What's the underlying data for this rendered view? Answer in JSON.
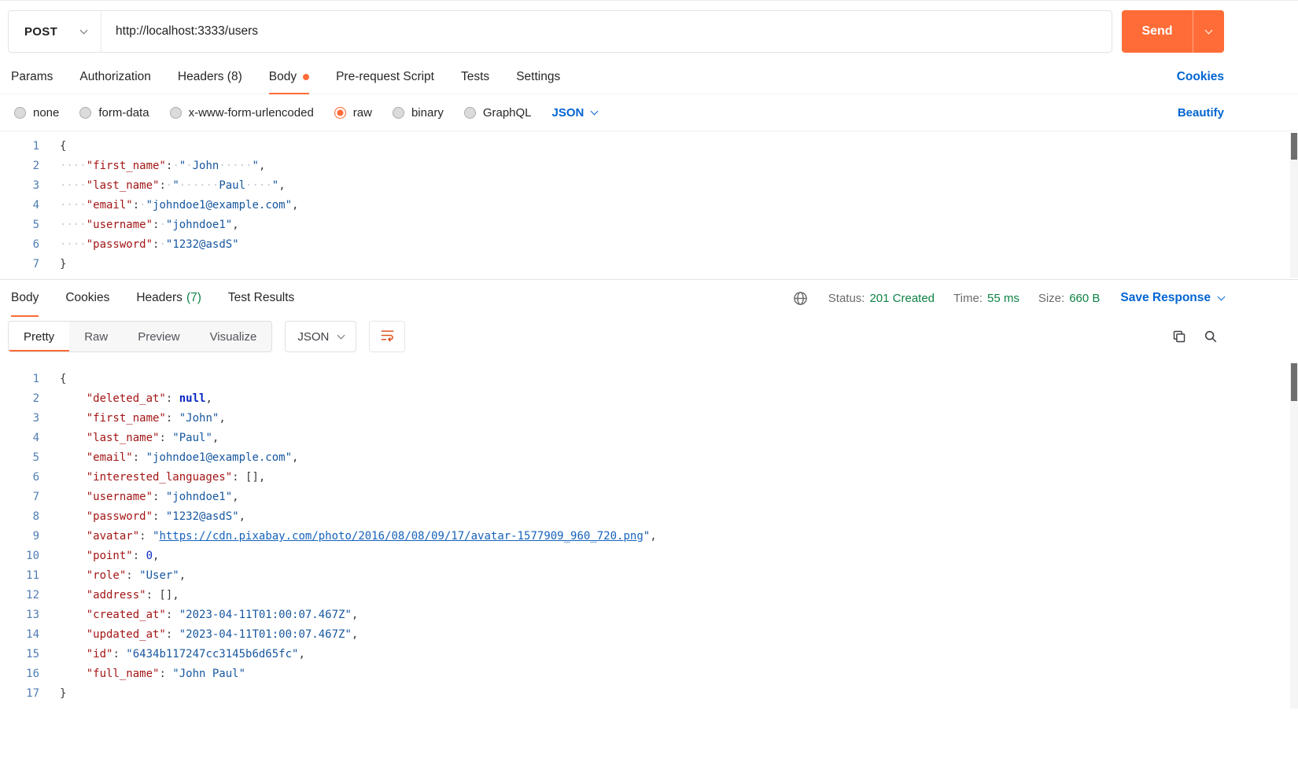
{
  "accent_color": "#FF6C37",
  "status_green": "#0E8345",
  "link_blue": "#0265D2",
  "request": {
    "method": "POST",
    "url": "http://localhost:3333/users",
    "send_label": "Send",
    "tabs": [
      "Params",
      "Authorization",
      "Headers (8)",
      "Body",
      "Pre-request Script",
      "Tests",
      "Settings"
    ],
    "active_tab": "Body",
    "cookies_link": "Cookies",
    "body_types": [
      "none",
      "form-data",
      "x-www-form-urlencoded",
      "raw",
      "binary",
      "GraphQL"
    ],
    "selected_body_type": "raw",
    "language": "JSON",
    "beautify_link": "Beautify",
    "editor_lines": [
      [
        {
          "c": "punc",
          "v": "{"
        }
      ],
      [
        {
          "c": "ws",
          "v": "····"
        },
        {
          "c": "key",
          "v": "\"first_name\""
        },
        {
          "c": "punc",
          "v": ":"
        },
        {
          "c": "ws",
          "v": "·"
        },
        {
          "c": "str",
          "v": "\""
        },
        {
          "c": "ws",
          "v": "·"
        },
        {
          "c": "str",
          "v": "John"
        },
        {
          "c": "ws",
          "v": "·····"
        },
        {
          "c": "str",
          "v": "\""
        },
        {
          "c": "punc",
          "v": ","
        }
      ],
      [
        {
          "c": "ws",
          "v": "····"
        },
        {
          "c": "key",
          "v": "\"last_name\""
        },
        {
          "c": "punc",
          "v": ":"
        },
        {
          "c": "ws",
          "v": "·"
        },
        {
          "c": "str",
          "v": "\""
        },
        {
          "c": "ws",
          "v": "······"
        },
        {
          "c": "str",
          "v": "Paul"
        },
        {
          "c": "ws",
          "v": "····"
        },
        {
          "c": "str",
          "v": "\""
        },
        {
          "c": "punc",
          "v": ","
        }
      ],
      [
        {
          "c": "ws",
          "v": "····"
        },
        {
          "c": "key",
          "v": "\"email\""
        },
        {
          "c": "punc",
          "v": ":"
        },
        {
          "c": "ws",
          "v": "·"
        },
        {
          "c": "str",
          "v": "\"johndoe1@example.com\""
        },
        {
          "c": "punc",
          "v": ","
        }
      ],
      [
        {
          "c": "ws",
          "v": "····"
        },
        {
          "c": "key",
          "v": "\"username\""
        },
        {
          "c": "punc",
          "v": ":"
        },
        {
          "c": "ws",
          "v": "·"
        },
        {
          "c": "str",
          "v": "\"johndoe1\""
        },
        {
          "c": "punc",
          "v": ","
        }
      ],
      [
        {
          "c": "ws",
          "v": "····"
        },
        {
          "c": "key",
          "v": "\"password\""
        },
        {
          "c": "punc",
          "v": ":"
        },
        {
          "c": "ws",
          "v": "·"
        },
        {
          "c": "str",
          "v": "\"1232@asdS\""
        }
      ],
      [
        {
          "c": "punc",
          "v": "}"
        }
      ]
    ]
  },
  "response": {
    "tabs": [
      "Body",
      "Cookies",
      "Headers",
      "Test Results"
    ],
    "headers_count": "(7)",
    "active_tab": "Body",
    "status_label": "Status:",
    "status_value": "201 Created",
    "time_label": "Time:",
    "time_value": "55 ms",
    "size_label": "Size:",
    "size_value": "660 B",
    "save_response_label": "Save Response",
    "view_tabs": [
      "Pretty",
      "Raw",
      "Preview",
      "Visualize"
    ],
    "active_view_tab": "Pretty",
    "language": "JSON",
    "body_lines": [
      [
        {
          "c": "punc",
          "v": "{"
        }
      ],
      [
        {
          "c": "sp",
          "v": "    "
        },
        {
          "c": "key",
          "v": "\"deleted_at\""
        },
        {
          "c": "punc",
          "v": ": "
        },
        {
          "c": "kw",
          "v": "null"
        },
        {
          "c": "punc",
          "v": ","
        }
      ],
      [
        {
          "c": "sp",
          "v": "    "
        },
        {
          "c": "key",
          "v": "\"first_name\""
        },
        {
          "c": "punc",
          "v": ": "
        },
        {
          "c": "str",
          "v": "\"John\""
        },
        {
          "c": "punc",
          "v": ","
        }
      ],
      [
        {
          "c": "sp",
          "v": "    "
        },
        {
          "c": "key",
          "v": "\"last_name\""
        },
        {
          "c": "punc",
          "v": ": "
        },
        {
          "c": "str",
          "v": "\"Paul\""
        },
        {
          "c": "punc",
          "v": ","
        }
      ],
      [
        {
          "c": "sp",
          "v": "    "
        },
        {
          "c": "key",
          "v": "\"email\""
        },
        {
          "c": "punc",
          "v": ": "
        },
        {
          "c": "str",
          "v": "\"johndoe1@example.com\""
        },
        {
          "c": "punc",
          "v": ","
        }
      ],
      [
        {
          "c": "sp",
          "v": "    "
        },
        {
          "c": "key",
          "v": "\"interested_languages\""
        },
        {
          "c": "punc",
          "v": ": [],"
        }
      ],
      [
        {
          "c": "sp",
          "v": "    "
        },
        {
          "c": "key",
          "v": "\"username\""
        },
        {
          "c": "punc",
          "v": ": "
        },
        {
          "c": "str",
          "v": "\"johndoe1\""
        },
        {
          "c": "punc",
          "v": ","
        }
      ],
      [
        {
          "c": "sp",
          "v": "    "
        },
        {
          "c": "key",
          "v": "\"password\""
        },
        {
          "c": "punc",
          "v": ": "
        },
        {
          "c": "str",
          "v": "\"1232@asdS\""
        },
        {
          "c": "punc",
          "v": ","
        }
      ],
      [
        {
          "c": "sp",
          "v": "    "
        },
        {
          "c": "key",
          "v": "\"avatar\""
        },
        {
          "c": "punc",
          "v": ": "
        },
        {
          "c": "str",
          "v": "\""
        },
        {
          "c": "link",
          "v": "https://cdn.pixabay.com/photo/2016/08/08/09/17/avatar-1577909_960_720.png"
        },
        {
          "c": "str",
          "v": "\""
        },
        {
          "c": "punc",
          "v": ","
        }
      ],
      [
        {
          "c": "sp",
          "v": "    "
        },
        {
          "c": "key",
          "v": "\"point\""
        },
        {
          "c": "punc",
          "v": ": "
        },
        {
          "c": "num",
          "v": "0"
        },
        {
          "c": "punc",
          "v": ","
        }
      ],
      [
        {
          "c": "sp",
          "v": "    "
        },
        {
          "c": "key",
          "v": "\"role\""
        },
        {
          "c": "punc",
          "v": ": "
        },
        {
          "c": "str",
          "v": "\"User\""
        },
        {
          "c": "punc",
          "v": ","
        }
      ],
      [
        {
          "c": "sp",
          "v": "    "
        },
        {
          "c": "key",
          "v": "\"address\""
        },
        {
          "c": "punc",
          "v": ": [],"
        }
      ],
      [
        {
          "c": "sp",
          "v": "    "
        },
        {
          "c": "key",
          "v": "\"created_at\""
        },
        {
          "c": "punc",
          "v": ": "
        },
        {
          "c": "str",
          "v": "\"2023-04-11T01:00:07.467Z\""
        },
        {
          "c": "punc",
          "v": ","
        }
      ],
      [
        {
          "c": "sp",
          "v": "    "
        },
        {
          "c": "key",
          "v": "\"updated_at\""
        },
        {
          "c": "punc",
          "v": ": "
        },
        {
          "c": "str",
          "v": "\"2023-04-11T01:00:07.467Z\""
        },
        {
          "c": "punc",
          "v": ","
        }
      ],
      [
        {
          "c": "sp",
          "v": "    "
        },
        {
          "c": "key",
          "v": "\"id\""
        },
        {
          "c": "punc",
          "v": ": "
        },
        {
          "c": "str",
          "v": "\"6434b117247cc3145b6d65fc\""
        },
        {
          "c": "punc",
          "v": ","
        }
      ],
      [
        {
          "c": "sp",
          "v": "    "
        },
        {
          "c": "key",
          "v": "\"full_name\""
        },
        {
          "c": "punc",
          "v": ": "
        },
        {
          "c": "str",
          "v": "\"John Paul\""
        }
      ],
      [
        {
          "c": "punc",
          "v": "}"
        }
      ]
    ]
  }
}
